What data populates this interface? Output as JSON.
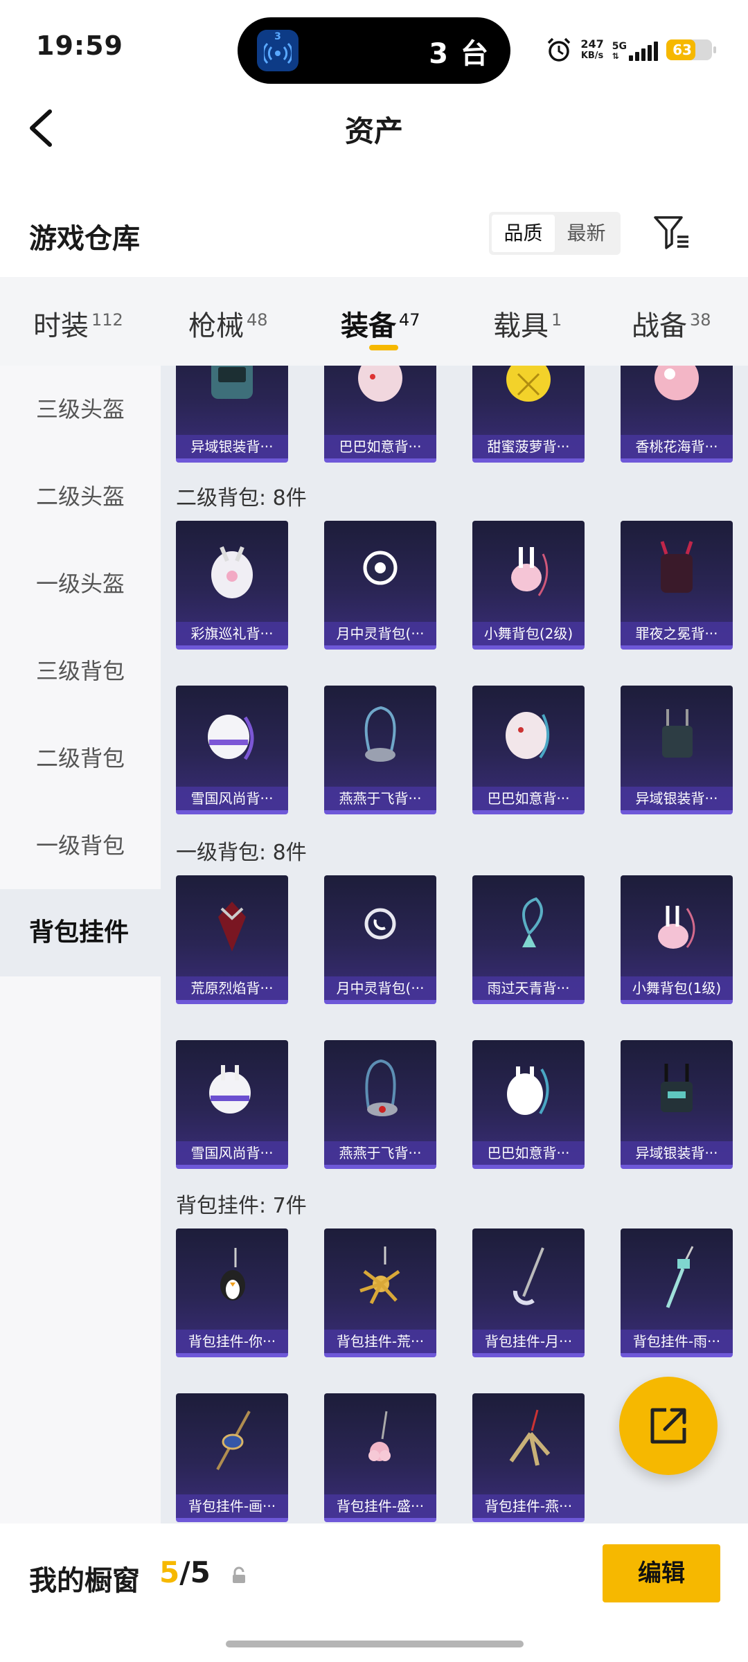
{
  "status_bar": {
    "time": "19:59",
    "island_app_badge": "3",
    "island_text": "3 台",
    "net_speed_value": "247",
    "net_speed_unit": "KB/s",
    "network": "5G",
    "battery": "63",
    "battery_level": 63,
    "icons": [
      "broadcast-icon",
      "alarm-icon",
      "signal-icon",
      "battery-icon"
    ]
  },
  "header": {
    "title": "资产",
    "back_icon": "chevron-left-icon"
  },
  "warehouse": {
    "title": "游戏仓库",
    "sort_options": [
      "品质",
      "最新"
    ],
    "sort_active": "品质",
    "filter_icon": "filter-icon"
  },
  "tabs": [
    {
      "label": "时装",
      "count": "112"
    },
    {
      "label": "枪械",
      "count": "48"
    },
    {
      "label": "装备",
      "count": "47"
    },
    {
      "label": "载具",
      "count": "1"
    },
    {
      "label": "战备",
      "count": "38"
    }
  ],
  "active_tab": "装备",
  "sidebar": {
    "items": [
      "三级头盔",
      "二级头盔",
      "一级头盔",
      "三级背包",
      "二级背包",
      "一级背包",
      "背包挂件"
    ],
    "active": "背包挂件"
  },
  "content": {
    "top_partial_row": [
      "异域银装背···",
      "巴巴如意背···",
      "甜蜜菠萝背···",
      "香桃花海背···"
    ],
    "groups": [
      {
        "title": "二级背包: 8件",
        "items": [
          "彩旗巡礼背···",
          "月中灵背包(···",
          "小舞背包(2级)",
          "罪夜之冕背···",
          "雪国风尚背···",
          "燕燕于飞背···",
          "巴巴如意背···",
          "异域银装背···"
        ]
      },
      {
        "title": "一级背包: 8件",
        "items": [
          "荒原烈焰背···",
          "月中灵背包(···",
          "雨过天青背···",
          "小舞背包(1级)",
          "雪国风尚背···",
          "燕燕于飞背···",
          "巴巴如意背···",
          "异域银装背···"
        ]
      },
      {
        "title": "背包挂件: 7件",
        "items": [
          "背包挂件-你···",
          "背包挂件-荒···",
          "背包挂件-月···",
          "背包挂件-雨···",
          "背包挂件-画···",
          "背包挂件-盛···",
          "背包挂件-燕···"
        ]
      }
    ]
  },
  "fab_icon": "share-external-icon",
  "bottom_bar": {
    "label": "我的橱窗",
    "current": "5",
    "separator": "/",
    "total": "5",
    "lock_icon": "lock-icon",
    "edit_label": "编辑"
  },
  "colors": {
    "accent": "#f6b800",
    "card_dark": "#1d1d3a",
    "card_label": "#4434a0",
    "content_bg": "#e9ecf1"
  }
}
